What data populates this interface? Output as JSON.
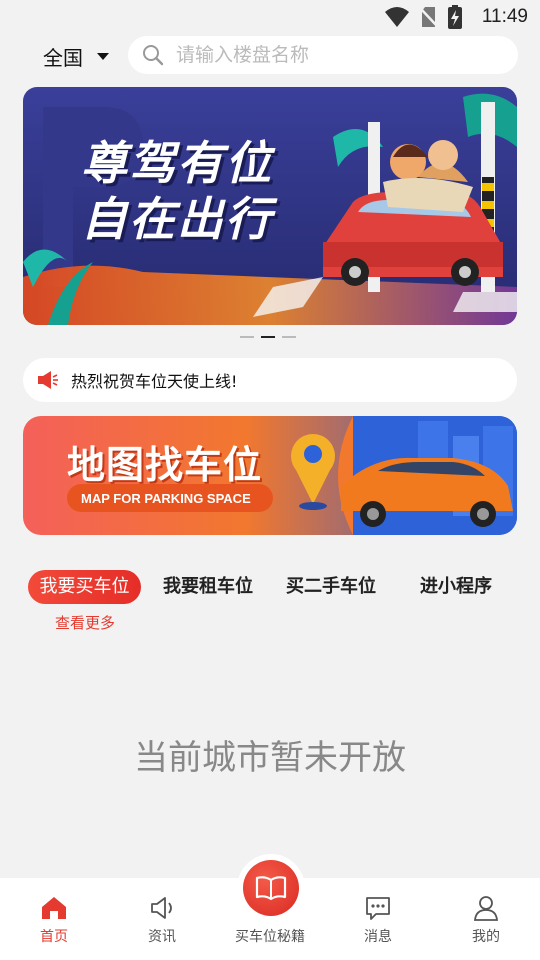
{
  "status": {
    "time": "11:49"
  },
  "header": {
    "city": "全国",
    "search_placeholder": "请输入楼盘名称"
  },
  "banner": {
    "line1": "尊驾有位",
    "line2": "自在出行",
    "slide_count": 3,
    "active_index": 1
  },
  "notice": {
    "text": "热烈祝贺车位天使上线!"
  },
  "map_banner": {
    "title": "地图找车位",
    "subtitle": "MAP FOR PARKING SPACE"
  },
  "tabs": [
    {
      "label": "我要买车位",
      "active": true
    },
    {
      "label": "我要租车位",
      "active": false
    },
    {
      "label": "买二手车位",
      "active": false
    },
    {
      "label": "进小程序",
      "active": false
    }
  ],
  "more_link": "查看更多",
  "empty_message": "当前城市暂未开放",
  "nav": [
    {
      "label": "首页",
      "icon": "home-icon",
      "active": true
    },
    {
      "label": "资讯",
      "icon": "speaker-icon",
      "active": false
    },
    {
      "label": "买车位秘籍",
      "icon": "book-icon",
      "active": false
    },
    {
      "label": "消息",
      "icon": "message-icon",
      "active": false
    },
    {
      "label": "我的",
      "icon": "user-icon",
      "active": false
    }
  ],
  "colors": {
    "accent": "#e53a2f",
    "banner_bg": "#2b2f7a",
    "map_banner_orange": "#f06a2a"
  }
}
